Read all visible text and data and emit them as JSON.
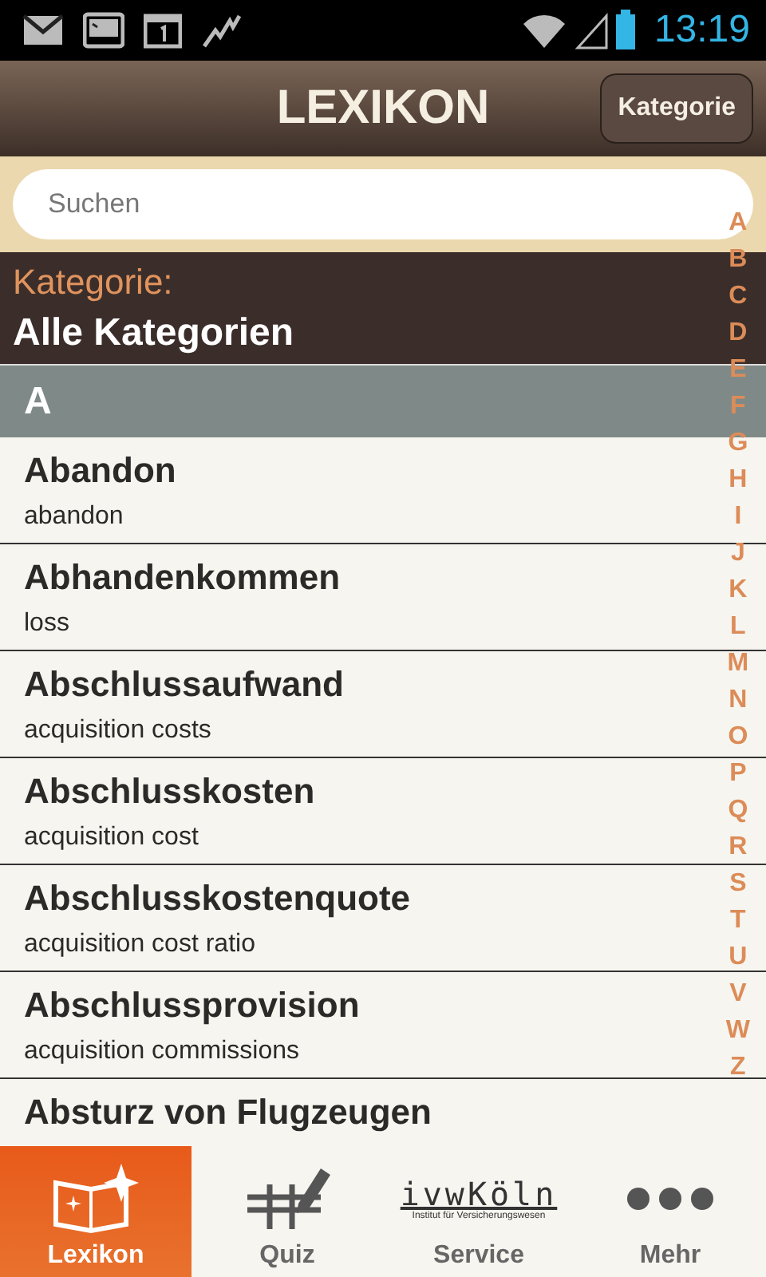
{
  "status_bar": {
    "time": "13:19"
  },
  "header": {
    "title": "LEXIKON",
    "button": "Kategorie"
  },
  "search": {
    "placeholder": "Suchen"
  },
  "category": {
    "label": "Kategorie:",
    "value": "Alle Kategorien"
  },
  "sections": [
    {
      "letter": "A",
      "entries": [
        {
          "term": "Abandon",
          "translation": "abandon"
        },
        {
          "term": "Abhandenkommen",
          "translation": "loss"
        },
        {
          "term": "Abschlussaufwand",
          "translation": "acquisition costs"
        },
        {
          "term": "Abschlusskosten",
          "translation": "acquisition cost"
        },
        {
          "term": "Abschlusskostenquote",
          "translation": "acquisition cost ratio"
        },
        {
          "term": "Abschlussprovision",
          "translation": "acquisition commissions"
        },
        {
          "term": "Absturz von Flugzeugen"
        }
      ]
    }
  ],
  "index_letters": [
    "A",
    "B",
    "C",
    "D",
    "E",
    "F",
    "G",
    "H",
    "I",
    "J",
    "K",
    "L",
    "M",
    "N",
    "O",
    "P",
    "Q",
    "R",
    "S",
    "T",
    "U",
    "V",
    "W",
    "Z"
  ],
  "tabs": [
    {
      "kind": "book",
      "label": "Lexikon",
      "selected": true
    },
    {
      "kind": "quiz",
      "label": "Quiz",
      "selected": false
    },
    {
      "kind": "logo",
      "label": "Service",
      "selected": false,
      "logo": "ivwKöln",
      "logo_subtitle": "Institut für Versicherungswesen"
    },
    {
      "kind": "more",
      "label": "Mehr",
      "selected": false
    }
  ]
}
